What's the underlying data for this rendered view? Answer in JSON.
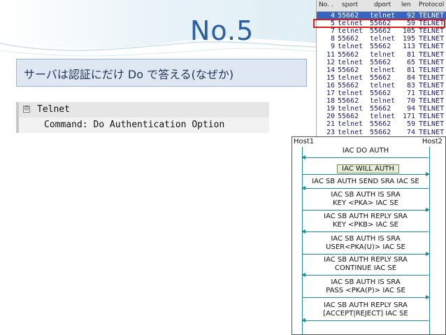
{
  "slide": {
    "title": "No.5",
    "subtitle": "サーバは認証にだけ Do で答える(なぜか)"
  },
  "tree": {
    "toggle": "⊟",
    "protocol": "Telnet",
    "command": "Command: Do Authentication Option"
  },
  "packet_list": {
    "headers": [
      "No. .",
      "sport",
      "dport",
      "len",
      "Protocol"
    ],
    "rows": [
      {
        "no": "4",
        "sport": "55662",
        "dport": "telnet",
        "len": "92",
        "proto": "TELNET",
        "selected": true
      },
      {
        "no": "5",
        "sport": "telnet",
        "dport": "55662",
        "len": "59",
        "proto": "TELNET"
      },
      {
        "no": "7",
        "sport": "telnet",
        "dport": "55662",
        "len": "105",
        "proto": "TELNET"
      },
      {
        "no": "8",
        "sport": "55662",
        "dport": "telnet",
        "len": "195",
        "proto": "TELNET"
      },
      {
        "no": "9",
        "sport": "telnet",
        "dport": "55662",
        "len": "113",
        "proto": "TELNET"
      },
      {
        "no": "11",
        "sport": "55662",
        "dport": "telnet",
        "len": "81",
        "proto": "TELNET"
      },
      {
        "no": "12",
        "sport": "telnet",
        "dport": "55662",
        "len": "65",
        "proto": "TELNET"
      },
      {
        "no": "14",
        "sport": "55662",
        "dport": "telnet",
        "len": "81",
        "proto": "TELNET"
      },
      {
        "no": "15",
        "sport": "telnet",
        "dport": "55662",
        "len": "84",
        "proto": "TELNET"
      },
      {
        "no": "16",
        "sport": "55662",
        "dport": "telnet",
        "len": "83",
        "proto": "TELNET"
      },
      {
        "no": "17",
        "sport": "telnet",
        "dport": "55662",
        "len": "71",
        "proto": "TELNET"
      },
      {
        "no": "18",
        "sport": "55662",
        "dport": "telnet",
        "len": "70",
        "proto": "TELNET"
      },
      {
        "no": "19",
        "sport": "telnet",
        "dport": "55662",
        "len": "94",
        "proto": "TELNET"
      },
      {
        "no": "20",
        "sport": "55662",
        "dport": "telnet",
        "len": "171",
        "proto": "TELNET"
      },
      {
        "no": "21",
        "sport": "telnet",
        "dport": "55662",
        "len": "59",
        "proto": "TELNET"
      },
      {
        "no": "23",
        "sport": "telnet",
        "dport": "55662",
        "len": "74",
        "proto": "TELNET"
      }
    ]
  },
  "sequence": {
    "host1": "Host1",
    "host2": "Host2",
    "messages": [
      {
        "text": "IAC DO AUTH",
        "dir": "l"
      },
      {
        "text": "IAC WILL AUTH",
        "dir": "r"
      },
      {
        "text": "IAC SB AUTH SEND SRA IAC SE",
        "dir": "l"
      },
      {
        "text": "IAC SB AUTH IS SRA\nKEY <PKA> IAC SE",
        "dir": "r"
      },
      {
        "text": "IAC SB AUTH REPLY SRA\nKEY <PKB> IAC SE",
        "dir": "l"
      },
      {
        "text": "IAC SB AUTH IS SRA\nUSER<PKA(U)> IAC SE",
        "dir": "r"
      },
      {
        "text": "IAC SB AUTH REPLY SRA\nCONTINUE IAC SE",
        "dir": "l"
      },
      {
        "text": "IAC SB AUTH IS SRA\nPASS <PKA(P)> IAC SE",
        "dir": "r"
      },
      {
        "text": "IAC SB AUTH REPLY SRA\n[ACCEPT|REJECT] IAC SE",
        "dir": "l"
      }
    ]
  },
  "colors": {
    "title": "#2a5fa3",
    "highlight": "#e01b1b",
    "selected_row": "#3565c0",
    "arrow": "#1d8a9e"
  }
}
